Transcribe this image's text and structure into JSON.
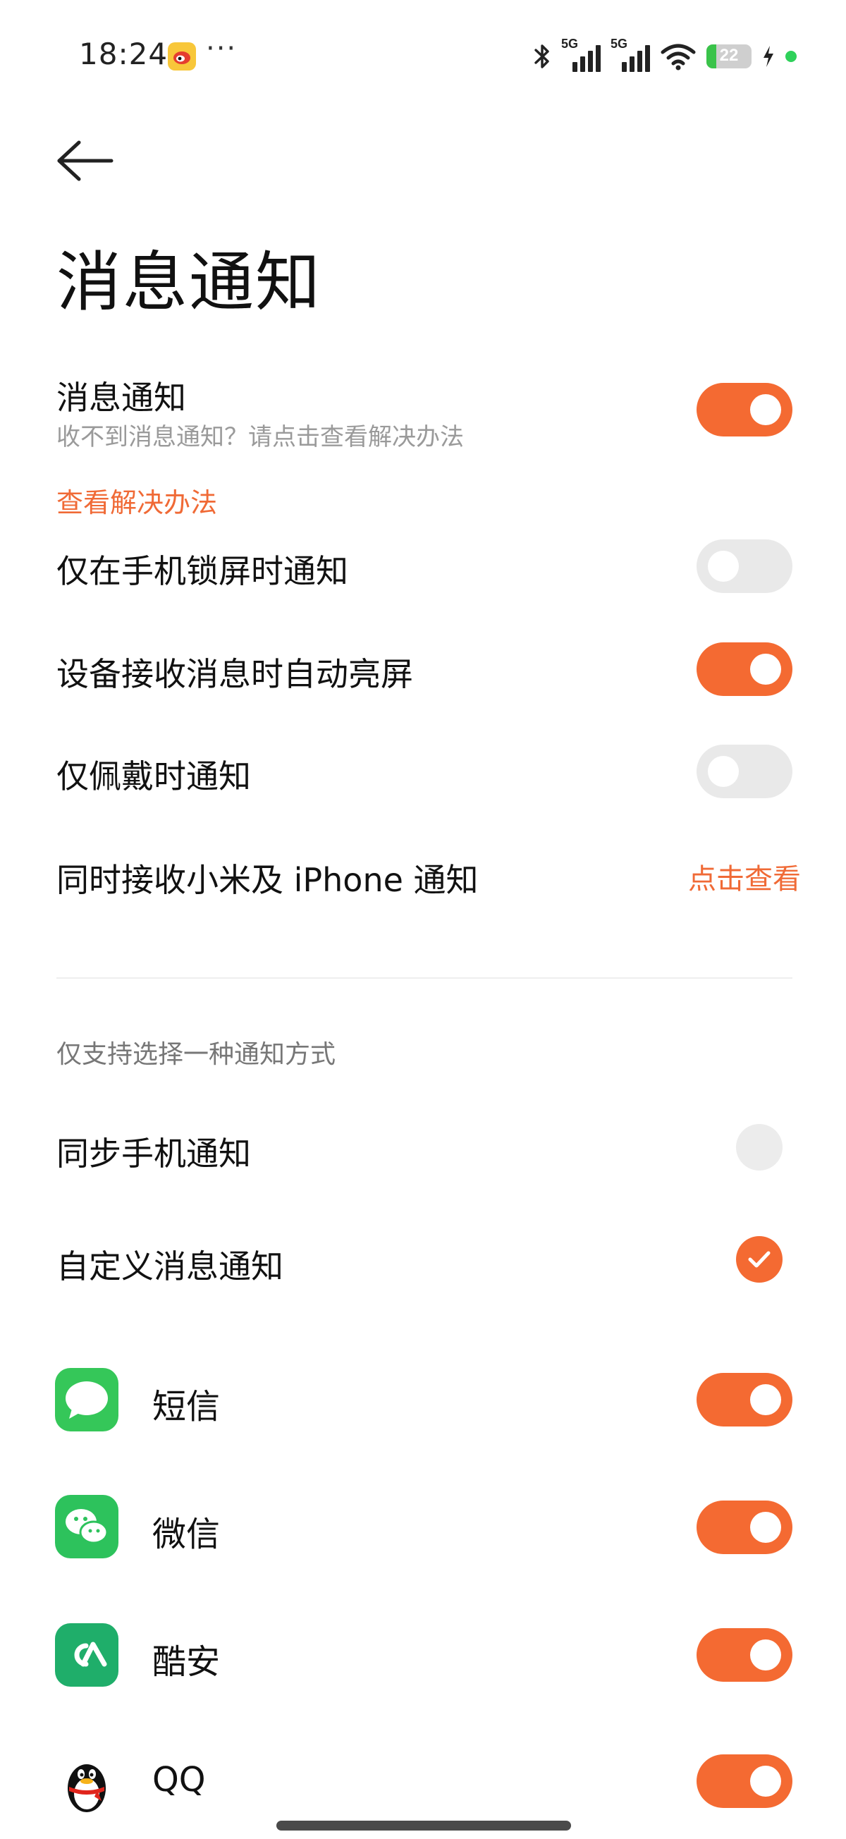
{
  "status_bar": {
    "time": "18:24",
    "more": "···",
    "network_1": "5G",
    "network_2": "5G",
    "battery_level": "22",
    "icons": [
      "weibo-icon",
      "bluetooth-icon",
      "signal-icon",
      "wifi-icon",
      "battery-icon",
      "charging-icon",
      "privacy-dot-icon"
    ]
  },
  "header": {
    "title": "消息通知"
  },
  "settings": {
    "notify": {
      "title": "消息通知",
      "subtitle": "收不到消息通知？请点击查看解决办法",
      "link": "查看解决办法",
      "enabled": true
    },
    "lock_only": {
      "title": "仅在手机锁屏时通知",
      "enabled": false
    },
    "wake_screen": {
      "title": "设备接收消息时自动亮屏",
      "enabled": true
    },
    "wear_only": {
      "title": "仅佩戴时通知",
      "enabled": false
    },
    "dual_receive": {
      "title": "同时接收小米及 iPhone 通知",
      "action": "点击查看"
    }
  },
  "mode_section": {
    "header": "仅支持选择一种通知方式",
    "options": [
      {
        "label": "同步手机通知",
        "selected": false
      },
      {
        "label": "自定义消息通知",
        "selected": true
      }
    ]
  },
  "apps": [
    {
      "name": "短信",
      "icon": "messages-icon",
      "enabled": true
    },
    {
      "name": "微信",
      "icon": "wechat-icon",
      "enabled": true
    },
    {
      "name": "酷安",
      "icon": "coolapk-icon",
      "enabled": true
    },
    {
      "name": "QQ",
      "icon": "qq-penguin-icon",
      "enabled": true
    }
  ],
  "colors": {
    "accent": "#f46a32",
    "link": "#f06a36",
    "toggle_off": "#e9e9e9",
    "messages_green": "#35c759",
    "wechat_green": "#2dc25c",
    "coolapk_green": "#1fae6a"
  }
}
